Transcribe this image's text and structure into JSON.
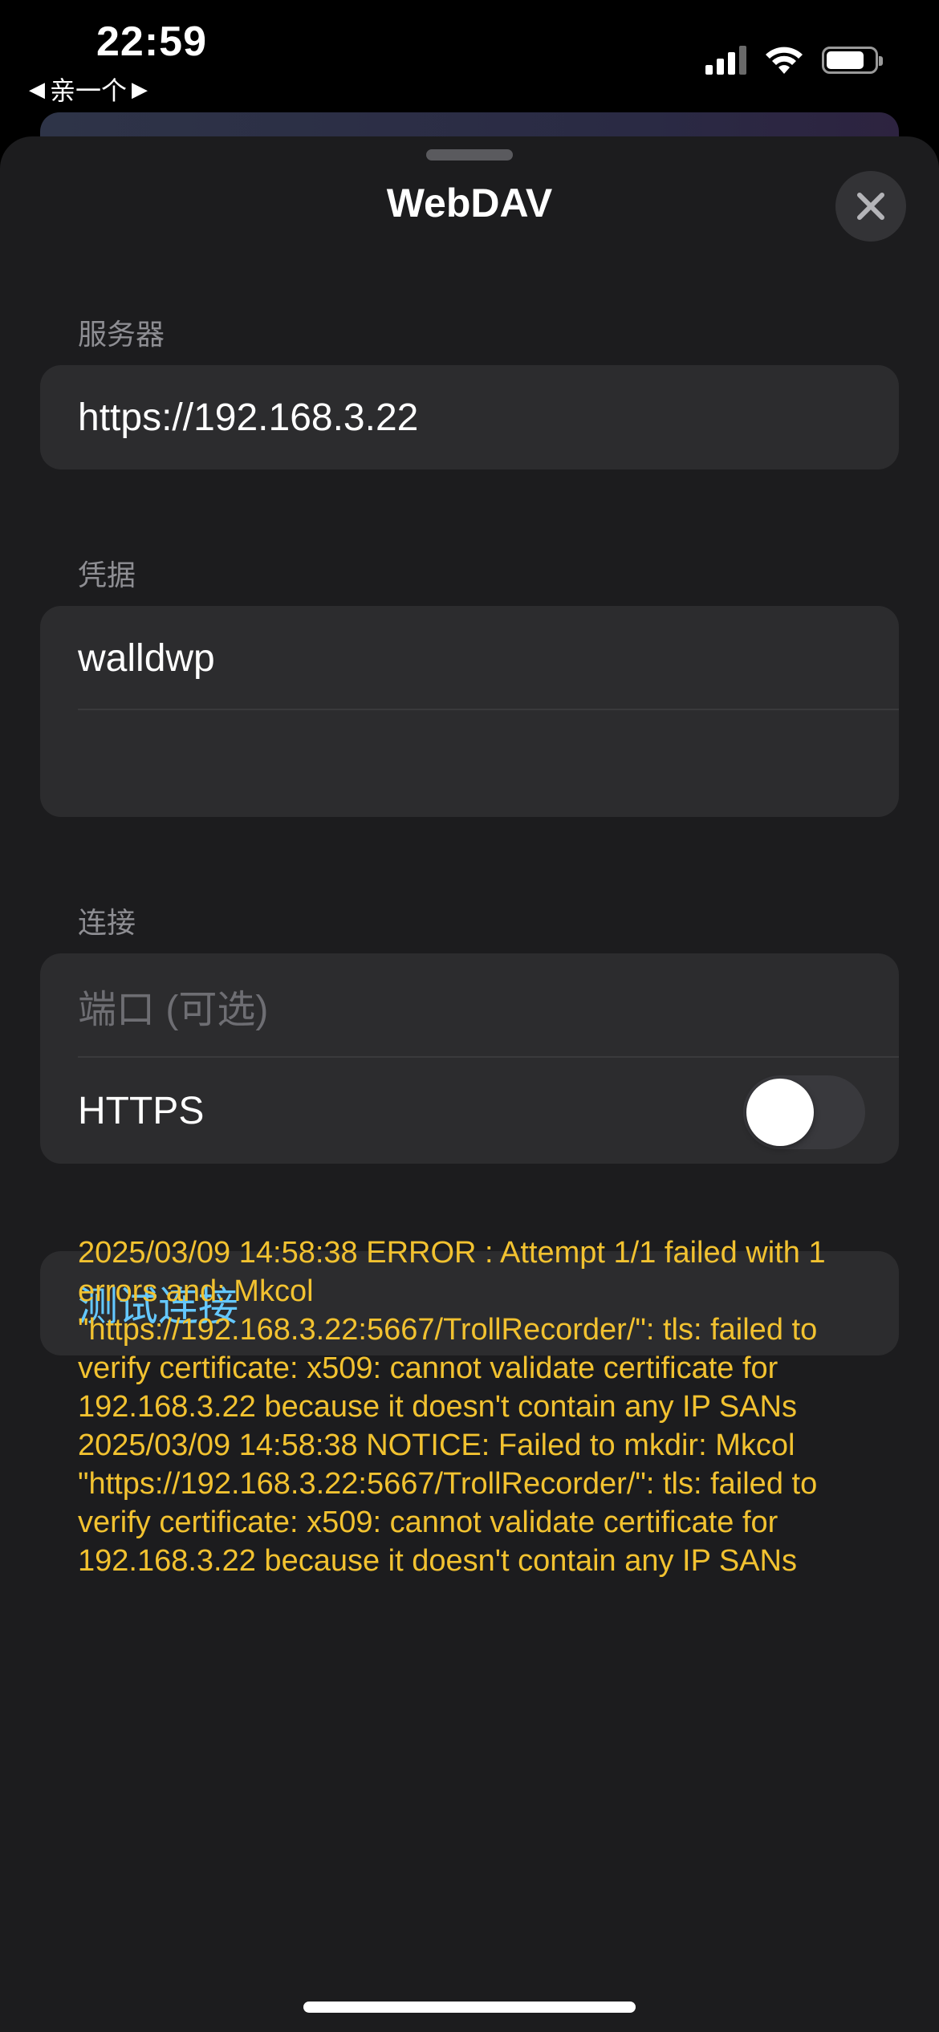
{
  "status_bar": {
    "time": "22:59",
    "back_label": "亲一个",
    "back_left_glyph": "◀",
    "back_right_glyph": "▶",
    "icons": [
      "cellular-signal-icon",
      "wifi-icon",
      "battery-icon"
    ],
    "battery_level": 0.8
  },
  "sheet": {
    "title": "WebDAV",
    "close_icon": "close-icon"
  },
  "server": {
    "label": "服务器",
    "value": "https://192.168.3.22"
  },
  "credentials": {
    "label": "凭据",
    "username_value": "walldwp",
    "password_value": ""
  },
  "connection": {
    "label": "连接",
    "port_placeholder": "端口 (可选)",
    "https_label": "HTTPS",
    "https_enabled": false
  },
  "test": {
    "button_label": "测试连接"
  },
  "log": {
    "lines": [
      "2025/03/09 14:58:38 ERROR : Attempt 1/1 failed with 1 errors and: Mkcol \"https://192.168.3.22:5667/TrollRecorder/\": tls: failed to verify certificate: x509: cannot validate certificate for 192.168.3.22 because it doesn't contain any IP SANs",
      "2025/03/09 14:58:38 NOTICE: Failed to mkdir: Mkcol \"https://192.168.3.22:5667/TrollRecorder/\": tls: failed to verify certificate: x509: cannot validate certificate for 192.168.3.22 because it doesn't contain any IP SANs"
    ]
  },
  "colors": {
    "background": "#000000",
    "sheet": "#1c1c1e",
    "group": "#2c2c2e",
    "accent": "#64c8ff",
    "log_text": "#f2c230",
    "secondary_text": "#8e8e93"
  }
}
